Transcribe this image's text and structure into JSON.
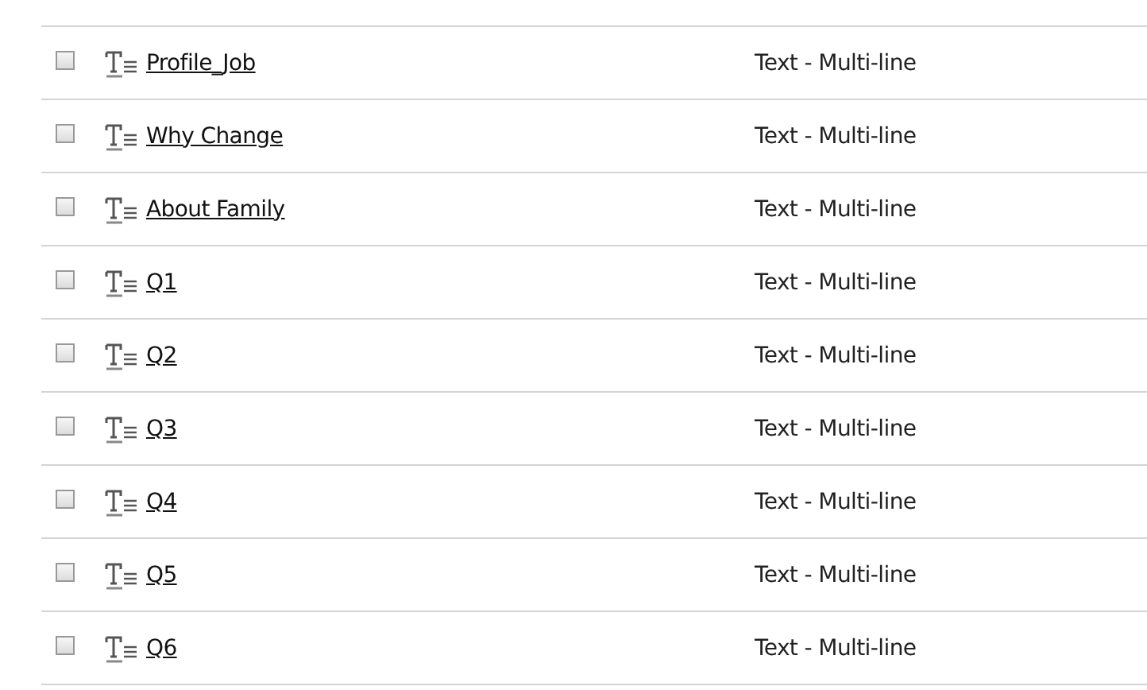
{
  "fields": [
    {
      "name": "Profile_Job",
      "type": "Text - Multi-line",
      "checked": false
    },
    {
      "name": "Why Change",
      "type": "Text - Multi-line",
      "checked": false
    },
    {
      "name": "About Family",
      "type": "Text - Multi-line",
      "checked": false
    },
    {
      "name": "Q1",
      "type": "Text - Multi-line",
      "checked": false
    },
    {
      "name": "Q2",
      "type": "Text - Multi-line",
      "checked": false
    },
    {
      "name": "Q3",
      "type": "Text - Multi-line",
      "checked": false
    },
    {
      "name": "Q4",
      "type": "Text - Multi-line",
      "checked": false
    },
    {
      "name": "Q5",
      "type": "Text - Multi-line",
      "checked": false
    },
    {
      "name": "Q6",
      "type": "Text - Multi-line",
      "checked": false
    }
  ]
}
